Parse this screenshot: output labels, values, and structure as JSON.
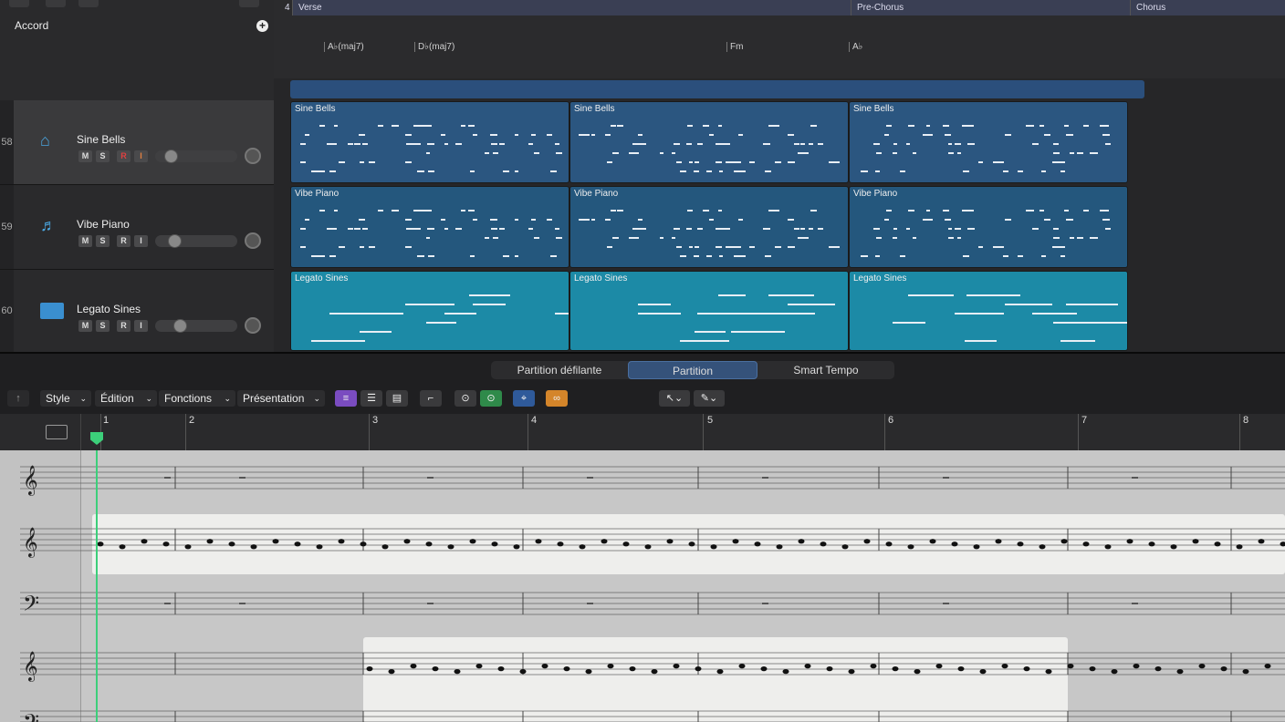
{
  "global_track": {
    "label": "Accord",
    "sections": [
      {
        "label": "4"
      },
      {
        "label": "Verse"
      },
      {
        "label": "Pre-Chorus"
      },
      {
        "label": "Chorus"
      }
    ],
    "chords": [
      "A♭(maj7)",
      "D♭(maj7)",
      "Fm",
      "A♭"
    ]
  },
  "tracks": [
    {
      "number": "58",
      "name": "Sine Bells",
      "buttons": [
        "M",
        "S",
        "R",
        "I"
      ],
      "volume": 0.2,
      "selected": true
    },
    {
      "number": "59",
      "name": "Vibe Piano",
      "buttons": [
        "M",
        "S",
        "R",
        "I"
      ],
      "volume": 0.25,
      "selected": false
    },
    {
      "number": "60",
      "name": "Legato Sines",
      "buttons": [
        "M",
        "S",
        "R",
        "I"
      ],
      "volume": 0.3,
      "selected": false
    }
  ],
  "regions": [
    {
      "track": 0,
      "label": "Sine Bells",
      "color": "#2b5680"
    },
    {
      "track": 0,
      "label": "Sine Bells",
      "color": "#2b5680"
    },
    {
      "track": 0,
      "label": "Sine Bells",
      "color": "#2b5680"
    },
    {
      "track": 1,
      "label": "Vibe Piano",
      "color": "#2b5680"
    },
    {
      "track": 1,
      "label": "Vibe Piano",
      "color": "#2b5680"
    },
    {
      "track": 1,
      "label": "Vibe Piano",
      "color": "#2b5680"
    },
    {
      "track": 2,
      "label": "Legato Sines",
      "color": "#1c8aa6"
    },
    {
      "track": 2,
      "label": "Legato Sines",
      "color": "#1c8aa6"
    },
    {
      "track": 2,
      "label": "Legato Sines",
      "color": "#1c8aa6"
    }
  ],
  "editor_tabs": [
    {
      "label": "Partition défilante",
      "active": false
    },
    {
      "label": "Partition",
      "active": true
    },
    {
      "label": "Smart Tempo",
      "active": false
    }
  ],
  "toolbar": {
    "menus": [
      "Style",
      "Édition",
      "Fonctions",
      "Présentation"
    ]
  },
  "ruler": {
    "bars": [
      "1",
      "2",
      "3",
      "4",
      "5",
      "6",
      "7",
      "8"
    ]
  },
  "colors": {
    "accent": "#2e5bd1",
    "playhead": "#3ccf7a",
    "link": "#e0903a"
  }
}
